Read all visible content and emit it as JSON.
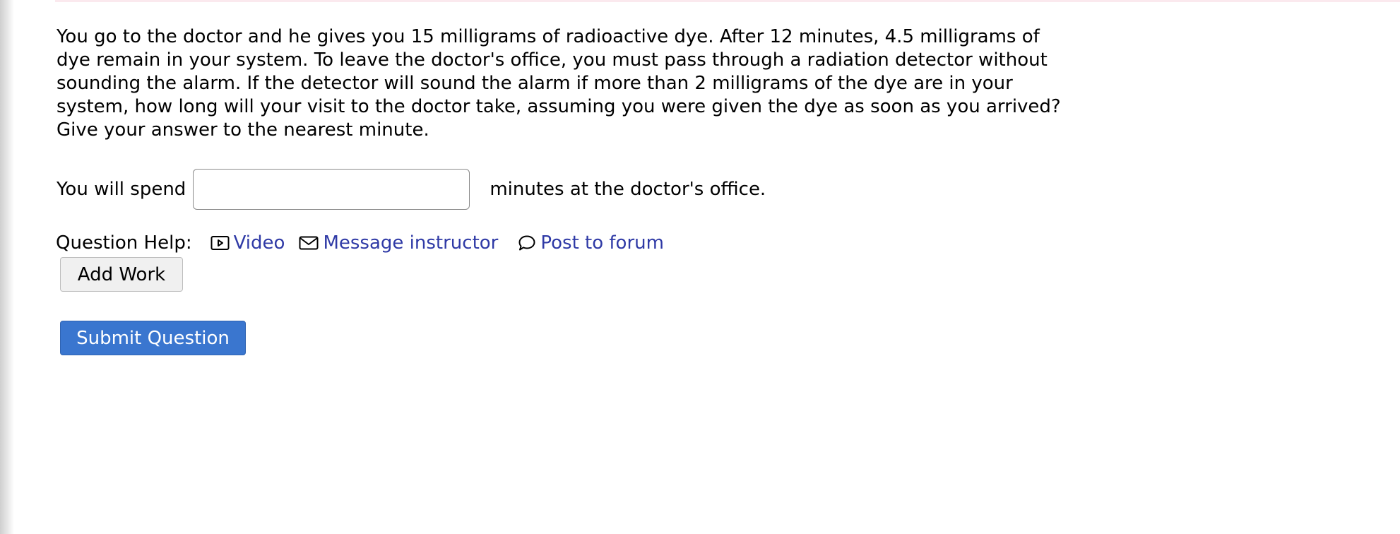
{
  "question": {
    "text": "You go to the doctor and he gives you 15 milligrams of radioactive dye. After 12 minutes, 4.5 milligrams of dye remain in your system. To leave the doctor's office, you must pass through a radiation detector without sounding the alarm. If the detector will sound the alarm if more than 2 milligrams of the dye are in your system, how long will your visit to the doctor take, assuming you were given the dye as soon as you arrived? Give your answer to the nearest minute."
  },
  "answer": {
    "prefix": "You will spend",
    "value": "",
    "placeholder": "",
    "suffix": "minutes at the doctor's office."
  },
  "help": {
    "label": "Question Help:",
    "links": [
      {
        "label": "Video",
        "icon": "video-icon"
      },
      {
        "label": "Message instructor",
        "icon": "envelope-icon"
      },
      {
        "label": "Post to forum",
        "icon": "speech-bubble-icon"
      }
    ]
  },
  "buttons": {
    "add_work": "Add Work",
    "submit": "Submit Question"
  },
  "colors": {
    "link": "#2f3aa6",
    "submit_bg": "#3a76cf"
  }
}
